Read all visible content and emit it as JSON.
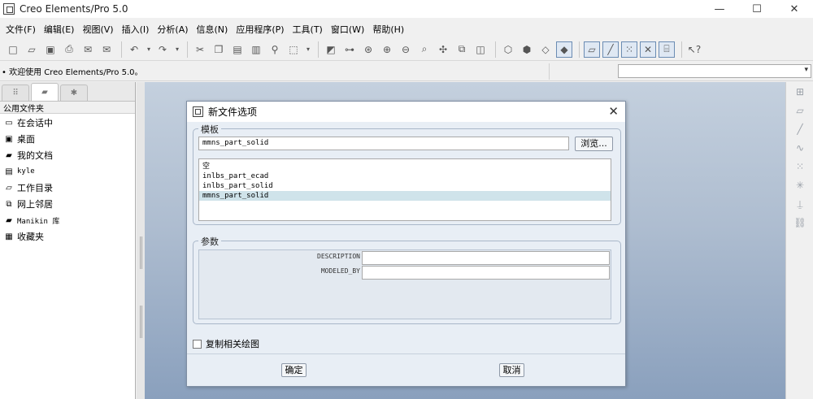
{
  "window": {
    "title": "Creo Elements/Pro 5.0",
    "controls": {
      "minimize": "—",
      "maximize": "☐",
      "close": "✕"
    }
  },
  "menubar": {
    "items": [
      "文件(F)",
      "编辑(E)",
      "视图(V)",
      "插入(I)",
      "分析(A)",
      "信息(N)",
      "应用程序(P)",
      "工具(T)",
      "窗口(W)",
      "帮助(H)"
    ]
  },
  "toolbar": {
    "icons": [
      "new-icon",
      "open-icon",
      "save-icon",
      "print-icon",
      "email-icon",
      "email-link-icon",
      "undo-icon",
      "redo-icon",
      "cut-icon",
      "copy-icon",
      "paste-icon",
      "paste-special-icon",
      "find-icon",
      "select-box-icon",
      "regenerate-icon",
      "regen-manager-icon",
      "datum-display-icon",
      "zoom-in-icon",
      "zoom-out-icon",
      "refit-icon",
      "reorient-icon",
      "saved-views-icon",
      "layers-icon",
      "wireframe-icon",
      "hidden-line-icon",
      "no-hidden-icon",
      "shading-icon",
      "datum-planes-icon",
      "datum-axes-icon",
      "datum-points-icon",
      "csys-icon",
      "annotation-icon",
      "whats-this-icon"
    ]
  },
  "status": {
    "message": "• 欢迎使用 Creo Elements/Pro 5.0。",
    "dropdown_value": ""
  },
  "navigator": {
    "header": "公用文件夹",
    "items": [
      {
        "label": "在会话中",
        "icon": "session-icon"
      },
      {
        "label": "桌面",
        "icon": "desktop-icon"
      },
      {
        "label": "我的文档",
        "icon": "documents-icon"
      },
      {
        "label": "kyle",
        "icon": "user-folder-icon"
      },
      {
        "label": "工作目录",
        "icon": "working-directory-icon"
      },
      {
        "label": "网上邻居",
        "icon": "network-icon"
      },
      {
        "label": "Manikin 库",
        "icon": "manikin-library-icon"
      },
      {
        "label": "收藏夹",
        "icon": "favorites-icon"
      }
    ]
  },
  "dialog": {
    "title": "新文件选项",
    "template_group_label": "模板",
    "template_value": "mmns_part_solid",
    "browse_label": "浏览...",
    "templates": [
      "空",
      "inlbs_part_ecad",
      "inlbs_part_solid",
      "mmns_part_solid"
    ],
    "selected_template_index": 3,
    "params_group_label": "参数",
    "params": [
      {
        "name": "DESCRIPTION",
        "value": ""
      },
      {
        "name": "MODELED_BY",
        "value": ""
      }
    ],
    "copy_drawing_label": "复制相关绘图",
    "copy_drawing_checked": false,
    "ok_label": "确定",
    "cancel_label": "取消"
  }
}
